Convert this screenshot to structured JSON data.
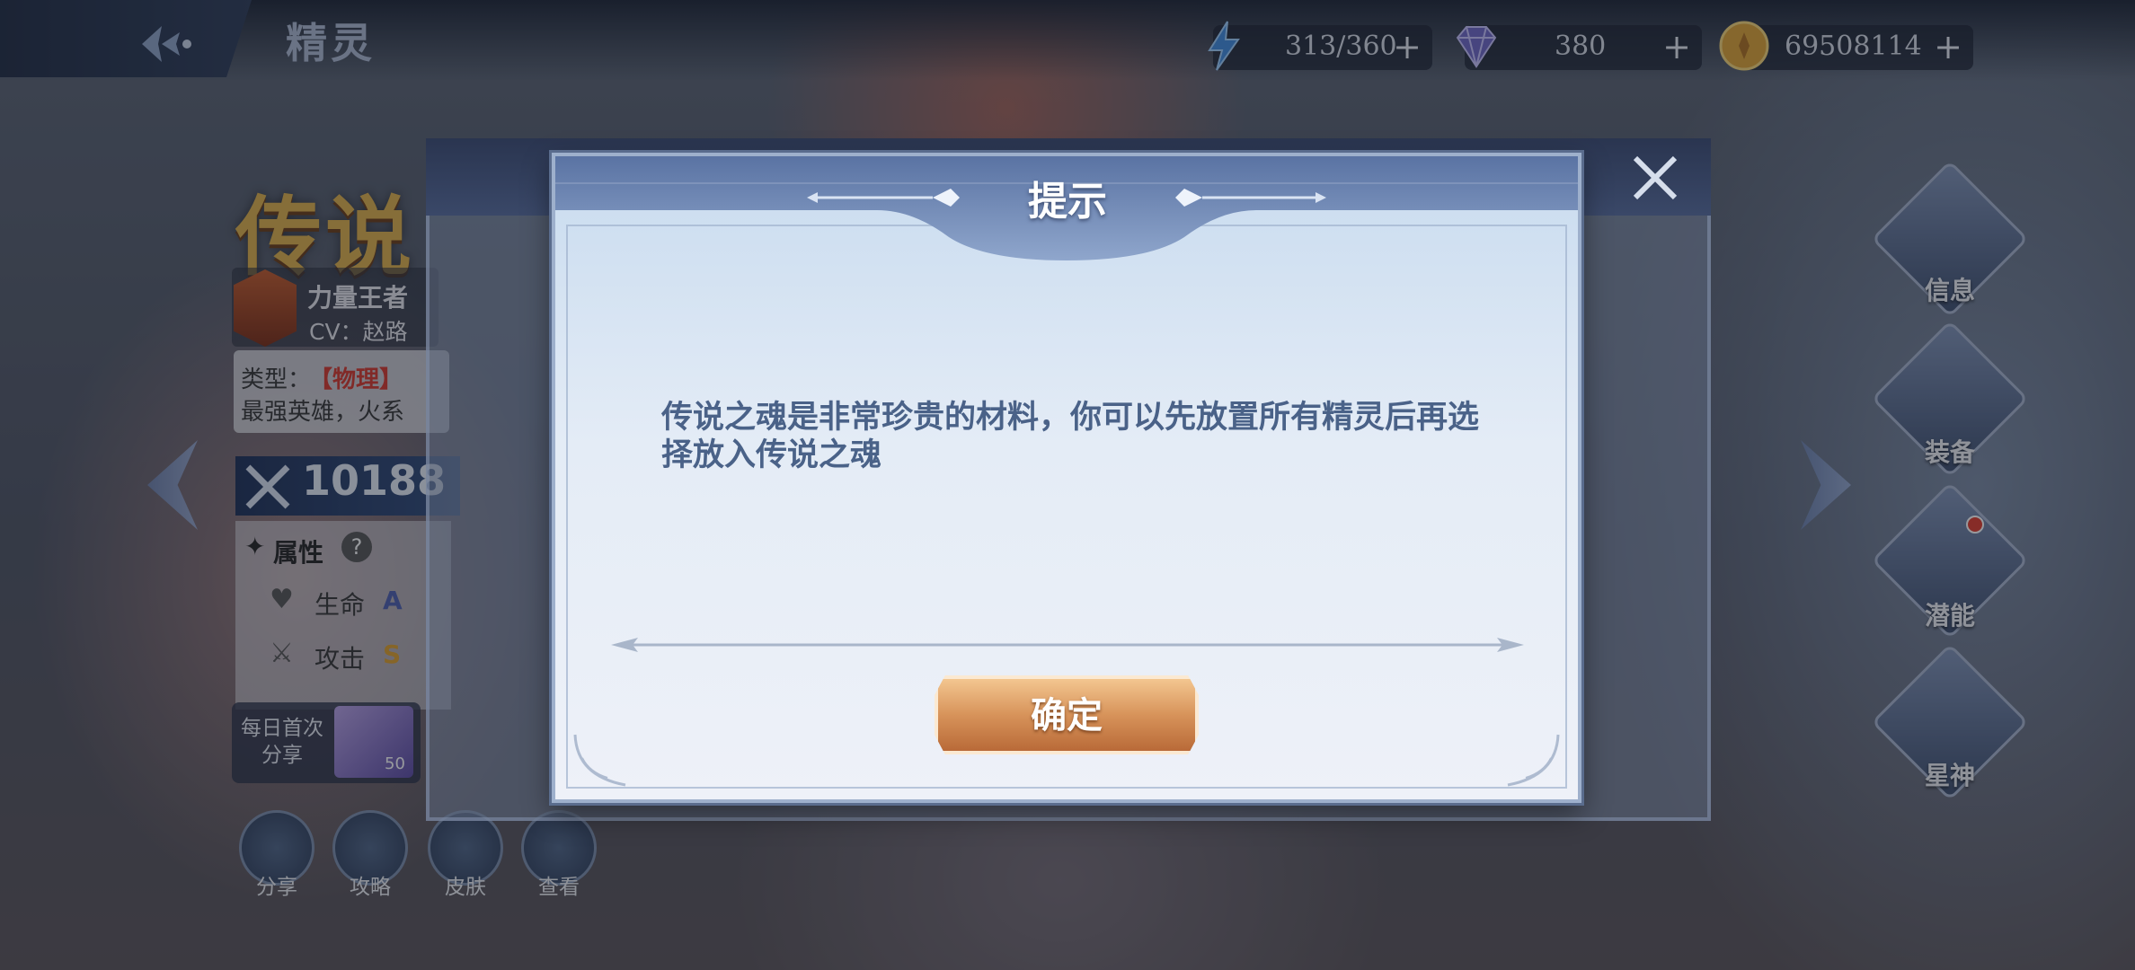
{
  "header": {
    "title": "精灵",
    "resources": [
      {
        "name": "energy",
        "icon": "lightning-icon",
        "value": "313/360"
      },
      {
        "name": "diamond",
        "icon": "diamond-icon",
        "value": "380"
      },
      {
        "name": "gold",
        "icon": "coin-icon",
        "value": "69508114"
      }
    ],
    "plus_symbol": "+"
  },
  "hero": {
    "rarity": "传说",
    "name": "力量王者",
    "cv": "CV：赵路",
    "type_label": "类型：",
    "type_value": "【物理】",
    "desc": "最强英雄，火系",
    "power": "10188",
    "attr_title": "属性",
    "attrs": [
      {
        "label": "生命",
        "grade": "A"
      },
      {
        "label": "攻击",
        "grade": "S"
      }
    ]
  },
  "share": {
    "daily_text": "每日首次分享",
    "gem_count": "50",
    "buttons": [
      "分享",
      "攻略",
      "皮肤",
      "查看"
    ]
  },
  "side_menu": [
    "信息",
    "装备",
    "潜能",
    "星神"
  ],
  "dialog": {
    "title": "提示",
    "message": "传说之魂是非常珍贵的材料，你可以先放置所有精灵后再选择放入传说之魂",
    "confirm": "确定"
  },
  "colors": {
    "dialog_text": "#4a6288",
    "confirm_btn": "#d7935a",
    "rarity_gold": "#e0b14a"
  }
}
